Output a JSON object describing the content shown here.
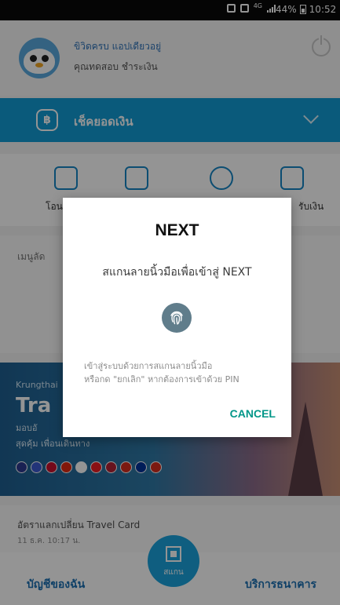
{
  "status_bar": {
    "network": "4G",
    "battery": "44%",
    "time": "10:52"
  },
  "header": {
    "greeting": "ขิวิดครบ แอปเดียวอยู่",
    "username": "คุณทดสอบ ชำระเงิน"
  },
  "balance_bar": {
    "currency_symbol": "฿",
    "label": "เช็คยอดเงิน"
  },
  "quick_menu": {
    "left_label": "โอน",
    "right_label": "รับเงิน"
  },
  "menu_card": {
    "title": "เมนูลัด"
  },
  "banner": {
    "brand": "Krungthai",
    "headline": "Tra",
    "line1": "มอบอั",
    "line2": "สุดคุ้ม เพื่อนเดินทาง"
  },
  "exchange": {
    "title": "อัตราแลกเปลี่ยน Travel Card",
    "date": "11 ธ.ค. 10:17 น."
  },
  "bottom_nav": {
    "left": "บัญชีของฉัน",
    "scan": "สแกน",
    "right": "บริการธนาคาร"
  },
  "dialog": {
    "title": "NEXT",
    "message": "สแกนลายนิ้วมือเพื่อเข้าสู่ NEXT",
    "hint_line1": "เข้าสู่ระบบด้วยการสแกนลายนิ้วมือ",
    "hint_line2": "หรือกด \"ยกเลิก\" หากต้องการเข้าด้วย PIN",
    "cancel_label": "CANCEL"
  },
  "colors": {
    "primary_blue": "#129bd4",
    "cancel_teal": "#009688",
    "fingerprint_bg": "#607d8b"
  }
}
